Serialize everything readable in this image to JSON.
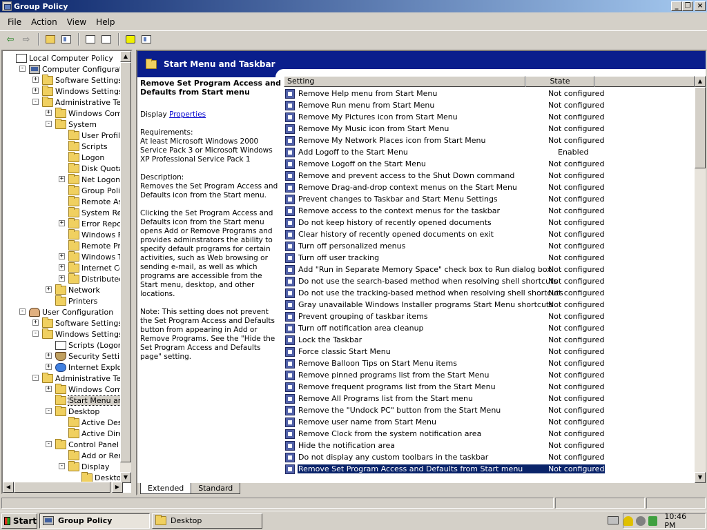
{
  "window": {
    "title": "Group Policy"
  },
  "menu": [
    "File",
    "Action",
    "View",
    "Help"
  ],
  "tree": {
    "nodes": [
      {
        "label": "Local Computer Policy",
        "icon": "doc-icon",
        "indent": 0,
        "exp": ""
      },
      {
        "label": "Computer Configuration",
        "icon": "computer-icon",
        "indent": 1,
        "exp": "-"
      },
      {
        "label": "Software Settings",
        "icon": "folder-icon",
        "indent": 2,
        "exp": "+"
      },
      {
        "label": "Windows Settings",
        "icon": "folder-icon",
        "indent": 2,
        "exp": "+"
      },
      {
        "label": "Administrative Templates",
        "icon": "folder-icon",
        "indent": 2,
        "exp": "-"
      },
      {
        "label": "Windows Components",
        "icon": "folder-icon",
        "indent": 3,
        "exp": "+"
      },
      {
        "label": "System",
        "icon": "folder-icon",
        "indent": 3,
        "exp": "-"
      },
      {
        "label": "User Profiles",
        "icon": "folder-icon",
        "indent": 4,
        "exp": ""
      },
      {
        "label": "Scripts",
        "icon": "folder-icon",
        "indent": 4,
        "exp": ""
      },
      {
        "label": "Logon",
        "icon": "folder-icon",
        "indent": 4,
        "exp": ""
      },
      {
        "label": "Disk Quotas",
        "icon": "folder-icon",
        "indent": 4,
        "exp": ""
      },
      {
        "label": "Net Logon",
        "icon": "folder-icon",
        "indent": 4,
        "exp": "+"
      },
      {
        "label": "Group Policy",
        "icon": "folder-icon",
        "indent": 4,
        "exp": ""
      },
      {
        "label": "Remote Assistance",
        "icon": "folder-icon",
        "indent": 4,
        "exp": ""
      },
      {
        "label": "System Restore",
        "icon": "folder-icon",
        "indent": 4,
        "exp": ""
      },
      {
        "label": "Error Reporting",
        "icon": "folder-icon",
        "indent": 4,
        "exp": "+"
      },
      {
        "label": "Windows File Protection",
        "icon": "folder-icon",
        "indent": 4,
        "exp": ""
      },
      {
        "label": "Remote Procedure Call",
        "icon": "folder-icon",
        "indent": 4,
        "exp": ""
      },
      {
        "label": "Windows Time Service",
        "icon": "folder-icon",
        "indent": 4,
        "exp": "+"
      },
      {
        "label": "Internet Communication Management",
        "icon": "folder-icon",
        "indent": 4,
        "exp": "+"
      },
      {
        "label": "Distributed COM",
        "icon": "folder-icon",
        "indent": 4,
        "exp": "+"
      },
      {
        "label": "Network",
        "icon": "folder-icon",
        "indent": 3,
        "exp": "+"
      },
      {
        "label": "Printers",
        "icon": "folder-icon",
        "indent": 3,
        "exp": ""
      },
      {
        "label": "User Configuration",
        "icon": "user-icon",
        "indent": 1,
        "exp": "-"
      },
      {
        "label": "Software Settings",
        "icon": "folder-icon",
        "indent": 2,
        "exp": "+"
      },
      {
        "label": "Windows Settings",
        "icon": "folder-icon",
        "indent": 2,
        "exp": "-"
      },
      {
        "label": "Scripts (Logon/Logoff)",
        "icon": "doc-icon",
        "indent": 3,
        "exp": ""
      },
      {
        "label": "Security Settings",
        "icon": "shield-icon",
        "indent": 3,
        "exp": "+"
      },
      {
        "label": "Internet Explorer Maintenance",
        "icon": "ie-icon",
        "indent": 3,
        "exp": "+"
      },
      {
        "label": "Administrative Templates",
        "icon": "folder-icon",
        "indent": 2,
        "exp": "-"
      },
      {
        "label": "Windows Components",
        "icon": "folder-icon",
        "indent": 3,
        "exp": "+"
      },
      {
        "label": "Start Menu and Taskbar",
        "icon": "folder-icon",
        "indent": 3,
        "exp": "",
        "selected": true
      },
      {
        "label": "Desktop",
        "icon": "folder-icon",
        "indent": 3,
        "exp": "-"
      },
      {
        "label": "Active Desktop",
        "icon": "folder-icon",
        "indent": 4,
        "exp": ""
      },
      {
        "label": "Active Directory",
        "icon": "folder-icon",
        "indent": 4,
        "exp": ""
      },
      {
        "label": "Control Panel",
        "icon": "folder-icon",
        "indent": 3,
        "exp": "-"
      },
      {
        "label": "Add or Remove Programs",
        "icon": "folder-icon",
        "indent": 4,
        "exp": ""
      },
      {
        "label": "Display",
        "icon": "folder-icon",
        "indent": 4,
        "exp": "-"
      },
      {
        "label": "Desktop Themes",
        "icon": "folder-icon",
        "indent": 5,
        "exp": ""
      }
    ]
  },
  "banner": {
    "title": "Start Menu and Taskbar"
  },
  "description": {
    "title": "Remove Set Program Access and Defaults from Start menu",
    "display_prefix": "Display",
    "properties_link": "Properties",
    "requirements": "Requirements:\nAt least Microsoft Windows 2000 Service Pack 3 or Microsoft Windows XP Professional Service Pack 1",
    "description": "Description:\nRemoves the Set Program Access and Defaults icon from the Start menu.",
    "details": "Clicking the Set Program Access and Defaults icon from the Start menu opens Add or Remove Programs and provides adminstrators the ability to specify default programs for certain activities, such as Web browsing or sending e-mail, as well as which programs are accessible from the Start menu, desktop, and other locations.",
    "note": "Note: This setting does not prevent the Set Program Access and Defaults button from appearing in Add or Remove Programs.  See the \"Hide the Set Program Access and Defaults page\" setting."
  },
  "list": {
    "columns": [
      "Setting",
      "State"
    ],
    "rows": [
      {
        "setting": "Remove Help menu from Start Menu",
        "state": "Not configured"
      },
      {
        "setting": "Remove Run menu from Start Menu",
        "state": "Not configured"
      },
      {
        "setting": "Remove My Pictures icon from Start Menu",
        "state": "Not configured"
      },
      {
        "setting": "Remove My Music icon from Start Menu",
        "state": "Not configured"
      },
      {
        "setting": "Remove My Network Places icon from Start Menu",
        "state": "Not configured"
      },
      {
        "setting": "Add Logoff to the Start Menu",
        "state": "Enabled"
      },
      {
        "setting": "Remove Logoff on the Start Menu",
        "state": "Not configured"
      },
      {
        "setting": "Remove and prevent access to the Shut Down command",
        "state": "Not configured"
      },
      {
        "setting": "Remove Drag-and-drop context menus on the Start Menu",
        "state": "Not configured"
      },
      {
        "setting": "Prevent changes to Taskbar and Start Menu Settings",
        "state": "Not configured"
      },
      {
        "setting": "Remove access to the context menus for the taskbar",
        "state": "Not configured"
      },
      {
        "setting": "Do not keep history of recently opened documents",
        "state": "Not configured"
      },
      {
        "setting": "Clear history of recently opened documents on exit",
        "state": "Not configured"
      },
      {
        "setting": "Turn off personalized menus",
        "state": "Not configured"
      },
      {
        "setting": "Turn off user tracking",
        "state": "Not configured"
      },
      {
        "setting": "Add \"Run in Separate Memory Space\" check box to Run dialog box",
        "state": "Not configured"
      },
      {
        "setting": "Do not use the search-based method when resolving shell shortcuts",
        "state": "Not configured"
      },
      {
        "setting": "Do not use the tracking-based method when resolving shell shortcuts",
        "state": "Not configured"
      },
      {
        "setting": "Gray unavailable Windows Installer programs Start Menu shortcuts",
        "state": "Not configured"
      },
      {
        "setting": "Prevent grouping of taskbar items",
        "state": "Not configured"
      },
      {
        "setting": "Turn off notification area cleanup",
        "state": "Not configured"
      },
      {
        "setting": "Lock the Taskbar",
        "state": "Not configured"
      },
      {
        "setting": "Force classic Start Menu",
        "state": "Not configured"
      },
      {
        "setting": "Remove Balloon Tips on Start Menu items",
        "state": "Not configured"
      },
      {
        "setting": "Remove pinned programs list from the Start Menu",
        "state": "Not configured"
      },
      {
        "setting": "Remove frequent programs list from the Start Menu",
        "state": "Not configured"
      },
      {
        "setting": "Remove All Programs list from the Start menu",
        "state": "Not configured"
      },
      {
        "setting": "Remove the \"Undock PC\" button from the Start Menu",
        "state": "Not configured"
      },
      {
        "setting": "Remove user name from Start Menu",
        "state": "Not configured"
      },
      {
        "setting": "Remove Clock from the system notification area",
        "state": "Not configured"
      },
      {
        "setting": "Hide the notification area",
        "state": "Not configured"
      },
      {
        "setting": "Do not display any custom toolbars in the taskbar",
        "state": "Not configured"
      },
      {
        "setting": "Remove Set Program Access and Defaults from Start menu",
        "state": "Not configured",
        "selected": true
      }
    ]
  },
  "tabs": [
    "Extended",
    "Standard"
  ],
  "taskbar": {
    "start_label": "Start",
    "buttons": [
      "Group Policy",
      "Desktop"
    ],
    "clock": "10:46 PM"
  },
  "colors": {
    "selection": "#0a246a",
    "banner": "#0a1e8c",
    "chrome": "#d4d0c8"
  }
}
